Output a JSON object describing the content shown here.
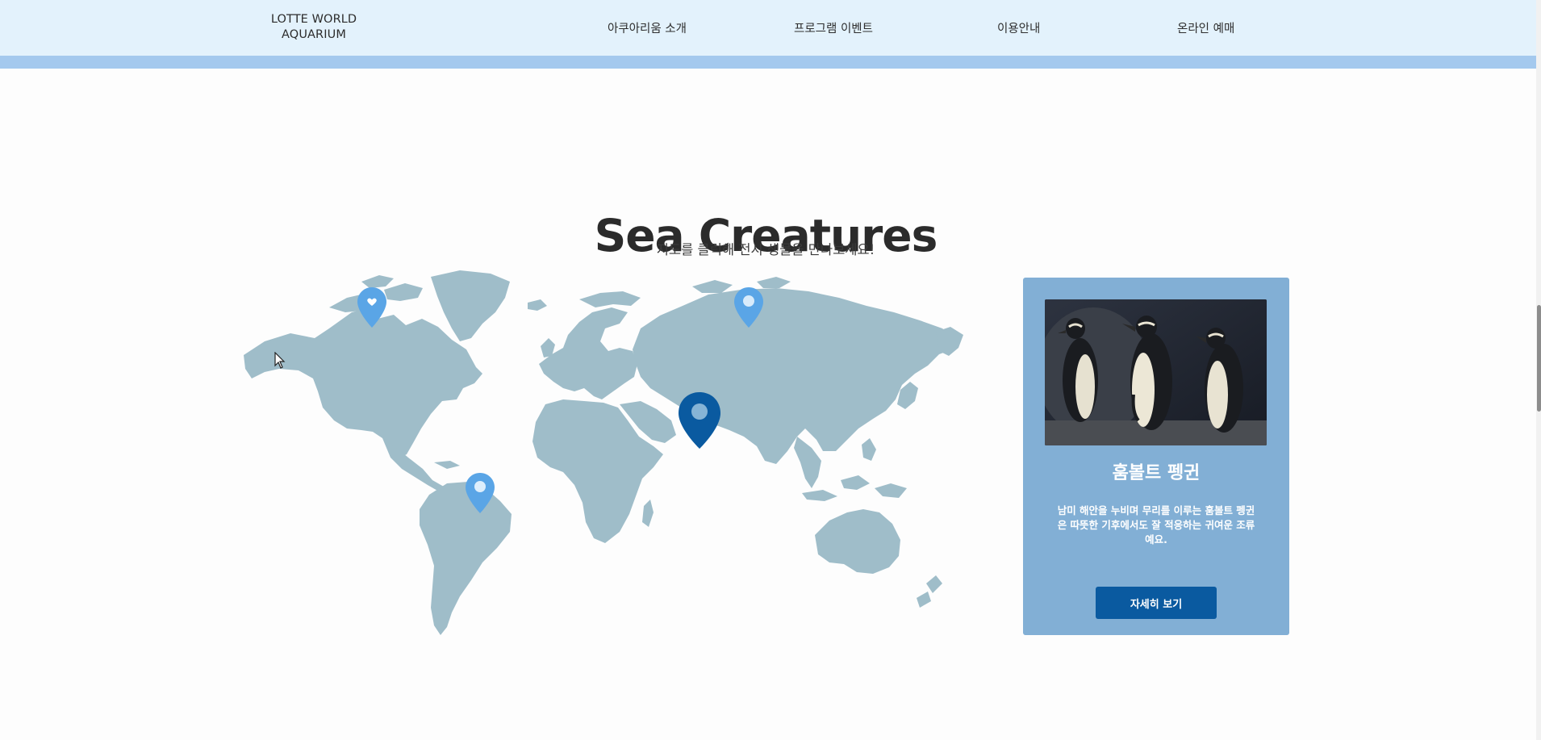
{
  "header": {
    "logo_line1": "LOTTE WORLD",
    "logo_line2": "AQUARIUM",
    "nav": [
      "아쿠아리움 소개",
      "프로그램 이벤트",
      "이용안내",
      "온라인 예매"
    ],
    "bg_color": "#e3f2fc",
    "stripe_color": "#a4c9ee"
  },
  "section": {
    "title": "Sea Creatures",
    "subtitle": "지도를 클릭해 전시 생물을 만나보세요!"
  },
  "map": {
    "land_color": "#9fbdc9",
    "pin_color": "#5aa5e6",
    "active_pin_color": "#0a5aa0",
    "pins": [
      {
        "name": "canada-pin",
        "icon": "heart",
        "active": false
      },
      {
        "name": "russia-pin",
        "icon": "dot",
        "active": false
      },
      {
        "name": "middle-east-pin",
        "icon": "dot",
        "active": true
      },
      {
        "name": "south-america-pin",
        "icon": "dot",
        "active": false
      }
    ]
  },
  "card": {
    "name": "훔볼트 펭귄",
    "description": "남미 해안을 누비며 무리를 이루는 훔볼트 펭귄은 따뜻한 기후에서도 잘 적응하는 귀여운 조류예요.",
    "button_label": "자세히 보기",
    "bg_color": "#82afd5",
    "button_color": "#0a5aa0"
  }
}
